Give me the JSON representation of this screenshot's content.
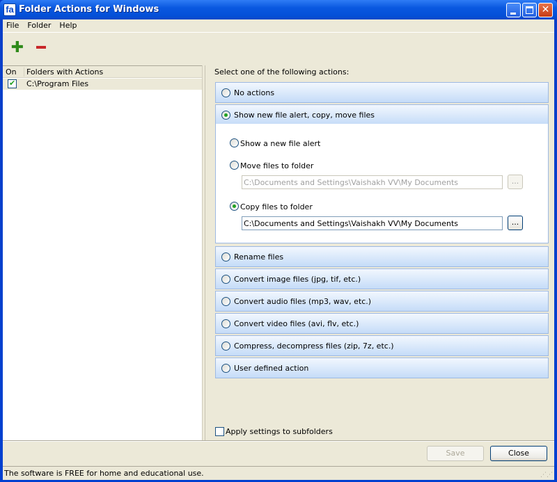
{
  "window": {
    "title": "Folder Actions for Windows",
    "icon_text": "fa",
    "controls": [
      "minimize",
      "maximize",
      "close"
    ]
  },
  "menu": [
    "File",
    "Folder",
    "Help"
  ],
  "toolbar": {
    "add": "add-folder",
    "remove": "remove-folder"
  },
  "folders": {
    "columns": [
      "On",
      "Folders with Actions"
    ],
    "rows": [
      {
        "checked": true,
        "path": "C:\\Program Files"
      }
    ]
  },
  "actions": {
    "prompt": "Select one of the following actions:",
    "options": [
      "No actions",
      "Show new file alert, copy, move files",
      "Rename files",
      "Convert image files (jpg, tif, etc.)",
      "Convert audio files (mp3, wav, etc.)",
      "Convert video files (avi, flv, etc.)",
      "Compress, decompress files (zip, 7z, etc.)",
      "User defined action"
    ],
    "selected": "Show new file alert, copy, move files",
    "sub": {
      "alert": "Show a new file alert",
      "move": "Move files to folder",
      "move_path": "C:\\Documents and Settings\\Vaishakh VV\\My Documents",
      "copy": "Copy files to folder",
      "copy_path": "C:\\Documents and Settings\\Vaishakh VV\\My Documents",
      "browse": "...",
      "selected": "Copy files to folder"
    }
  },
  "subfolders": {
    "label": "Apply settings to subfolders",
    "checked": false
  },
  "buttons": {
    "save": "Save",
    "close": "Close"
  },
  "status": "The software is FREE for home and educational use."
}
